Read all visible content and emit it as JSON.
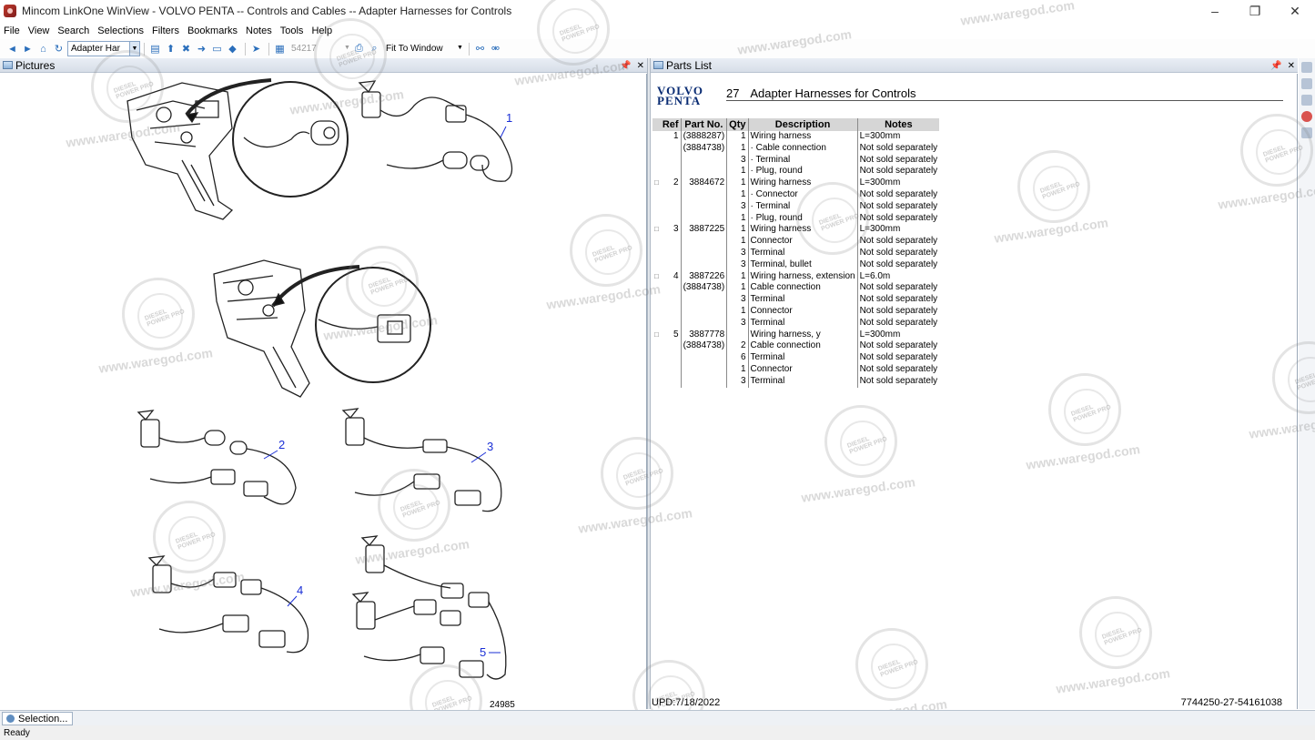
{
  "window": {
    "title": "Mincom LinkOne WinView - VOLVO PENTA -- Controls and Cables -- Adapter Harnesses for Controls",
    "controls": {
      "minimize": "–",
      "restore": "❐",
      "close": "✕"
    }
  },
  "menu": [
    "File",
    "View",
    "Search",
    "Selections",
    "Filters",
    "Bookmarks",
    "Notes",
    "Tools",
    "Help"
  ],
  "toolbar": {
    "book_combo": "Adapter Har",
    "page_combo": "54217",
    "zoom_combo": "Fit To Window"
  },
  "pictures_panel": {
    "title": "Pictures",
    "pin": "📌",
    "close": "✕",
    "callouts": [
      "1",
      "2",
      "3",
      "4",
      "5"
    ],
    "image_number": "24985"
  },
  "parts_panel": {
    "title": "Parts List",
    "pin": "📌",
    "close": "✕",
    "brand_line1": "VOLVO",
    "brand_line2": "PENTA",
    "section_number": "27",
    "section_title": "Adapter Harnesses for Controls",
    "columns": [
      "",
      "Ref",
      "Part No.",
      "Qty",
      "Description",
      "Notes"
    ],
    "rows": [
      {
        "sel": "",
        "ref": "1",
        "pn": "(3888287)",
        "qty": "1",
        "desc": "Wiring harness",
        "notes": "L=300mm"
      },
      {
        "sel": "",
        "ref": "",
        "pn": "(3884738)",
        "qty": "1",
        "desc": "· Cable connection",
        "notes": "Not sold separately"
      },
      {
        "sel": "",
        "ref": "",
        "pn": "",
        "qty": "3",
        "desc": "· Terminal",
        "notes": "Not sold separately"
      },
      {
        "sel": "",
        "ref": "",
        "pn": "",
        "qty": "1",
        "desc": "· Plug, round",
        "notes": "Not sold separately"
      },
      {
        "sel": "□",
        "ref": "2",
        "pn": "3884672",
        "qty": "1",
        "desc": "Wiring harness",
        "notes": "L=300mm"
      },
      {
        "sel": "",
        "ref": "",
        "pn": "",
        "qty": "1",
        "desc": "· Connector",
        "notes": "Not sold separately"
      },
      {
        "sel": "",
        "ref": "",
        "pn": "",
        "qty": "3",
        "desc": "· Terminal",
        "notes": "Not sold separately"
      },
      {
        "sel": "",
        "ref": "",
        "pn": "",
        "qty": "1",
        "desc": "· Plug, round",
        "notes": "Not sold separately"
      },
      {
        "sel": "□",
        "ref": "3",
        "pn": "3887225",
        "qty": "1",
        "desc": "Wiring harness",
        "notes": "L=300mm"
      },
      {
        "sel": "",
        "ref": "",
        "pn": "",
        "qty": "1",
        "desc": "Connector",
        "notes": "Not sold separately"
      },
      {
        "sel": "",
        "ref": "",
        "pn": "",
        "qty": "3",
        "desc": "Terminal",
        "notes": "Not sold separately"
      },
      {
        "sel": "",
        "ref": "",
        "pn": "",
        "qty": "3",
        "desc": "Terminal, bullet",
        "notes": "Not sold separately"
      },
      {
        "sel": "□",
        "ref": "4",
        "pn": "3887226",
        "qty": "1",
        "desc": "Wiring harness, extension",
        "notes": "L=6.0m"
      },
      {
        "sel": "",
        "ref": "",
        "pn": "(3884738)",
        "qty": "1",
        "desc": "Cable connection",
        "notes": "Not sold separately"
      },
      {
        "sel": "",
        "ref": "",
        "pn": "",
        "qty": "3",
        "desc": "Terminal",
        "notes": "Not sold separately"
      },
      {
        "sel": "",
        "ref": "",
        "pn": "",
        "qty": "1",
        "desc": "Connector",
        "notes": "Not sold separately"
      },
      {
        "sel": "",
        "ref": "",
        "pn": "",
        "qty": "3",
        "desc": "Terminal",
        "notes": "Not sold separately"
      },
      {
        "sel": "□",
        "ref": "5",
        "pn": "3887778",
        "qty": "",
        "desc": "Wiring harness, y",
        "notes": "L=300mm"
      },
      {
        "sel": "",
        "ref": "",
        "pn": "(3884738)",
        "qty": "2",
        "desc": "Cable connection",
        "notes": "Not sold separately"
      },
      {
        "sel": "",
        "ref": "",
        "pn": "",
        "qty": "6",
        "desc": "Terminal",
        "notes": "Not sold separately"
      },
      {
        "sel": "",
        "ref": "",
        "pn": "",
        "qty": "1",
        "desc": "Connector",
        "notes": "Not sold separately"
      },
      {
        "sel": "",
        "ref": "",
        "pn": "",
        "qty": "3",
        "desc": "Terminal",
        "notes": "Not sold separately"
      }
    ],
    "footer_left": "UPD:7/18/2022",
    "footer_right": "7744250-27-54161038"
  },
  "bottom_tab": "Selection...",
  "status": "Ready",
  "watermark_text": "www.waregod.com",
  "watermark_seal": "DIESEL POWER PRO"
}
